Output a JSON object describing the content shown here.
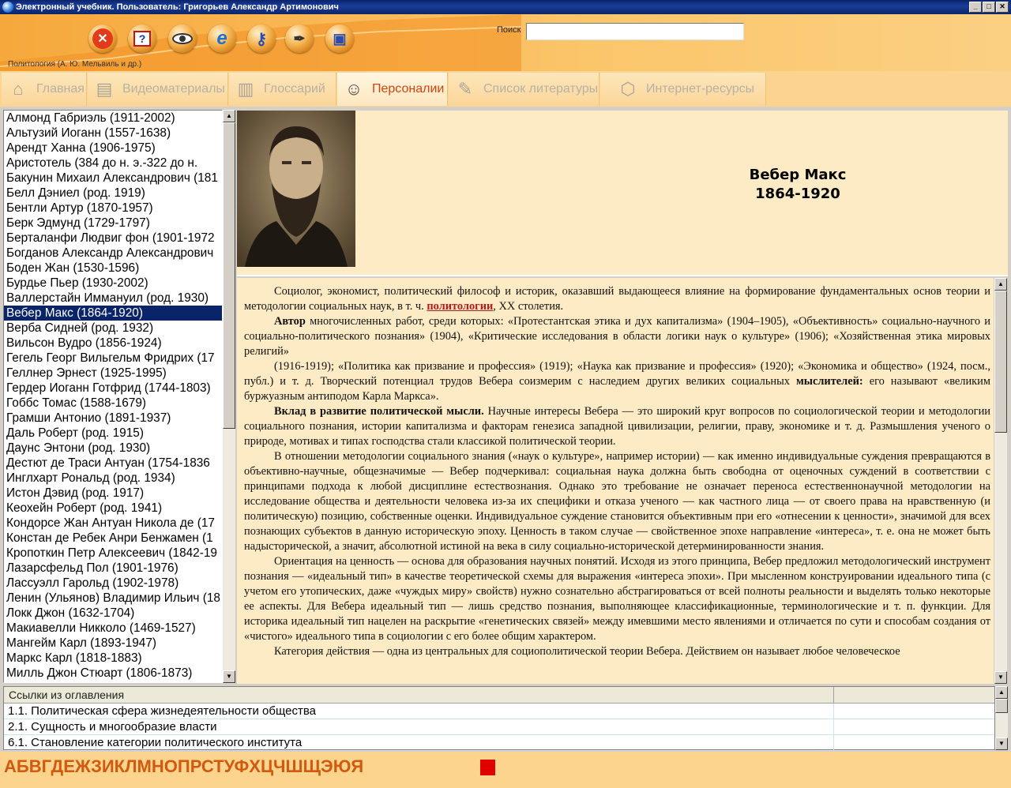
{
  "window": {
    "title": "Электронный учебник. Пользователь: Григорьев Александр Артимонович"
  },
  "toolbar": {
    "buttons": [
      "close-icon",
      "help-icon",
      "eye-icon",
      "browser-icon",
      "key-icon",
      "pens-icon",
      "computer-icon"
    ],
    "search_label": "Поиск",
    "search_value": "",
    "course_label": "Политология (А. Ю. Мельвиль и др.)"
  },
  "tabs": [
    {
      "label": "Главная",
      "icon": "home-icon"
    },
    {
      "label": "Видеоматериалы",
      "icon": "video-icon"
    },
    {
      "label": "Глоссарий",
      "icon": "books-icon"
    },
    {
      "label": "Персоналии",
      "icon": "person-icon",
      "active": true
    },
    {
      "label": "Список литературы",
      "icon": "book-pen-icon"
    },
    {
      "label": "Интернет-ресурсы",
      "icon": "network-icon"
    }
  ],
  "persons": [
    "Алмонд Габриэль  (1911-2002)",
    "Альтузий Иоганн  (1557-1638)",
    "Арендт Ханна  (1906-1975)",
    "Аристотель   (384 до н. э.-322 до н.",
    "Бакунин Михаил Александрович  (181",
    "Белл Дэниел  (род. 1919)",
    "Бентли Артур  (1870-1957)",
    "Берк Эдмунд  (1729-1797)",
    "Берталанфи Людвиг фон  (1901-1972",
    "Богданов Александр Александрович",
    "Боден Жан  (1530-1596)",
    "Бурдье Пьер  (1930-2002)",
    "Валлерстайн Иммануил  (род. 1930)",
    "Вебер Макс  (1864-1920)",
    "Верба Сидней  (род. 1932)",
    "Вильсон Вудро  (1856-1924)",
    "Гегель Георг Вильгельм Фридрих  (17",
    "Геллнер Эрнест  (1925-1995)",
    "Гердер Иоганн Готфрид  (1744-1803)",
    "Гоббс Томас  (1588-1679)",
    "Грамши Антонио  (1891-1937)",
    "Даль Роберт  (род. 1915)",
    "Даунс Энтони  (род. 1930)",
    "Дестют де Траси Антуан  (1754-1836",
    "Инглхарт Рональд  (род. 1934)",
    "Истон Дэвид  (род. 1917)",
    "Кеохейн Роберт  (род. 1941)",
    "Кондорсе Жан Антуан Никола де  (17",
    "Констан де Ребек Анри Бенжамен  (1",
    "Кропоткин Петр Алексеевич  (1842-19",
    "Лазарсфельд Пол  (1901-1976)",
    "Лассуэлл Гарольд  (1902-1978)",
    "Ленин (Ульянов) Владимир Ильич  (18",
    "Локк Джон  (1632-1704)",
    "Макиавелли Никколо  (1469-1527)",
    "Мангейм Карл  (1893-1947)",
    "Маркс Карл  (1818-1883)",
    "Милль Джон Стюарт  (1806-1873)"
  ],
  "selected_index": 13,
  "detail": {
    "name": "Вебер Макс",
    "years": "1864-1920",
    "paragraphs": [
      {
        "pre": "Социолог, экономист, политический философ и историк, оказавший выдающееся влияние на формирование фундаментальных основ теории и методологии социальных наук, в т. ч. ",
        "link": "политологии",
        "post": ", XX столетия."
      },
      {
        "bold": "Автор",
        "text": " многочисленных работ, среди которых: «Протестантская этика и дух капитализма» (1904–1905), «Объективность» социально-научного и социально-политического познания» (1904), «Критические исследования в области логики наук о культуре» (1906); «Хозяйственная этика мировых религий»"
      },
      {
        "text": "(1916-1919); «Политика как призвание и профессия» (1919); «Наука как призвание и профессия» (1920); «Экономика и общество» (1924, посм., публ.) и т. д. Творческий потенциал трудов Вебера соизмерим с наследием других великих социальных ",
        "bold2": "мыслителей:",
        "text2": " его называют «великим буржуазным антиподом Карла Маркса»."
      },
      {
        "bold": "Вклад в развитие политической мысли.",
        "text": " Научные интересы Вебера — это широкий круг вопросов по социологической теории и методологии социального познания, истории капитализма и факторам генезиса западной цивилизации, религии, праву, экономике и т. д. Размышления ученого о природе, мотивах и типах господства стали классикой политической теории."
      },
      {
        "text": "В отношении методологии социального знания («наук о культуре», например истории) — как именно индивидуальные суждения превращаются в объективно-научные, общезначимые — Вебер подчеркивал: социальная наука должна быть свободна от оценочных суждений в соответствии с принципами подхода к любой дисциплине естествознания. Однако это требование не означает переноса естественнонаучной методологии на исследование общества и деятельности человека из-за их специфики и отказа ученого — как частного лица — от своего права на нравственную (и политическую) позицию, собственные оценки. Индивидуальное суждение становится объективным при его «отнесении к ценности», значимой для всех познающих субъектов в данную историческую эпоху. Ценность в таком случае — свойственное эпохе направление «интереса», т. е. она не может быть надысторической, а значит, абсолютной истиной на века в силу социально-исторической детерминированности знания."
      },
      {
        "text": "Ориентация на ценность — основа для образования научных понятий. Исходя из этого принципа, Вебер предложил методологический инструмент познания — «идеальный тип» в качестве теоретической схемы для выражения «интереса эпохи». При мысленном конструировании идеального типа (с учетом его утопических, даже «чуждых миру» свойств) нужно сознательно абстрагироваться от всей полноты реальности и выделять только некоторые ее аспекты. Для Вебера идеальный тип — лишь средство познания, выполняющее классификационные, терминологические и т. п. функции. Для историка идеальный тип нацелен на раскрытие «генетических связей» между имевшими место явлениями и отличается по сути и способам создания от «чистого» идеального типа в социологии с его более общим характером."
      },
      {
        "text": "Категория действия — одна из центральных для социополитической теории Вебера. Действием он называет любое человеческое"
      }
    ]
  },
  "links": {
    "header": "Ссылки из оглавления",
    "rows": [
      "1.1. Политическая сфера жизнедеятельности общества",
      "2.1. Сущность и многообразие власти",
      "6.1. Становление категории политического института"
    ]
  },
  "alphabet": "АБВГДЕЖЗИКЛМНОПРСТУФХЦЧШЩЭЮЯ",
  "colors": {
    "accent": "#d6420c",
    "selection": "#0a246a",
    "panel": "#fdebc5",
    "alphabet": "#d05a10"
  }
}
